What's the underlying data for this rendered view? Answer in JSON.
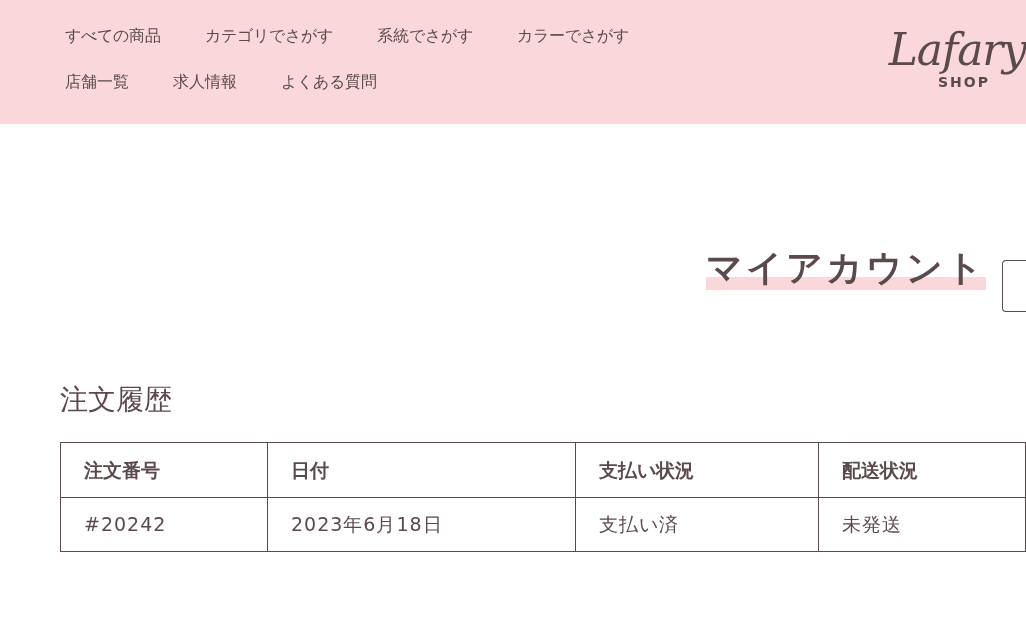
{
  "nav": {
    "rows": [
      [
        "すべての商品",
        "カテゴリでさがす",
        "系統でさがす",
        "カラーでさがす"
      ],
      [
        "店舗一覧",
        "求人情報",
        "よくある質問"
      ]
    ]
  },
  "logo": {
    "name": "Lafary",
    "sub": "SHOP"
  },
  "page_title": "マイアカウント",
  "section_title": "注文履歴",
  "table": {
    "columns": [
      "注文番号",
      "日付",
      "支払い状況",
      "配送状況"
    ],
    "rows": [
      [
        "#20242",
        "2023年6月18日",
        "支払い済",
        "未発送"
      ]
    ]
  }
}
